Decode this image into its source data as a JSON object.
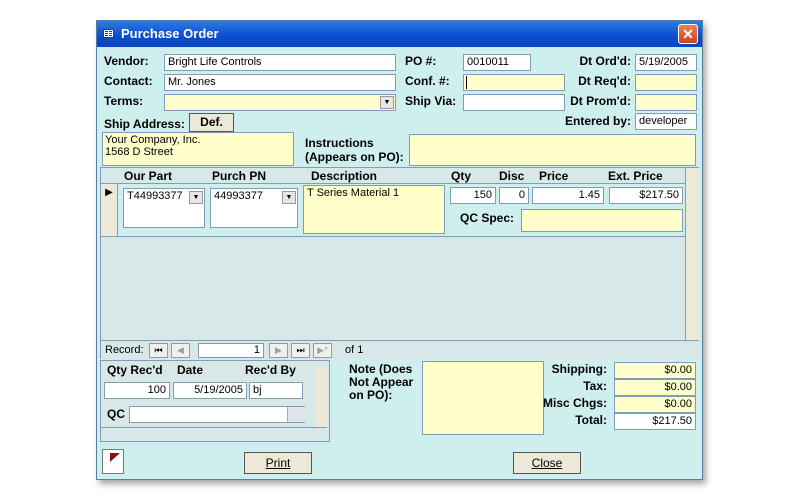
{
  "window": {
    "title": "Purchase Order",
    "close_glyph": "✕"
  },
  "header": {
    "vendor_label": "Vendor:",
    "vendor_value": "Bright Life Controls",
    "contact_label": "Contact:",
    "contact_value": "Mr. Jones",
    "terms_label": "Terms:",
    "terms_value": "",
    "po_label": "PO #:",
    "po_value": "0010011",
    "conf_label": "Conf. #:",
    "conf_value": "",
    "shipvia_label": "Ship Via:",
    "shipvia_value": "",
    "dtord_label": "Dt Ord'd:",
    "dtord_value": "5/19/2005",
    "dtreq_label": "Dt Req'd:",
    "dtreq_value": "",
    "dtprom_label": "Dt Prom'd:",
    "dtprom_value": "",
    "entered_label": "Entered by:",
    "entered_value": "developer",
    "ship_address_label": "Ship Address:",
    "def_button": "Def.",
    "ship_address_line1": "Your Company, Inc.",
    "ship_address_line2": "1568 D Street",
    "instructions_label_1": "Instructions",
    "instructions_label_2": "(Appears on PO):",
    "instructions_value": ""
  },
  "lines": {
    "columns": {
      "our_part": "Our Part",
      "purch_pn": "Purch PN",
      "description": "Description",
      "qty": "Qty",
      "disc": "Disc",
      "price": "Price",
      "ext_price": "Ext. Price"
    },
    "row": {
      "our_part": "T44993377",
      "purch_pn": "44993377",
      "description": "T Series Material 1",
      "qty": "150",
      "disc": "0",
      "price": "1.45",
      "ext_price": "$217.50"
    },
    "qc_spec_label": "QC Spec:",
    "qc_spec_value": "",
    "record_label": "Record:",
    "record_current": "1",
    "record_of": "of 1"
  },
  "receiving": {
    "qty_recd_label": "Qty Rec'd",
    "date_label": "Date",
    "recd_by_label": "Rec'd By",
    "qty_recd_value": "100",
    "date_value": "5/19/2005",
    "recd_by_value": "bj",
    "qc_label": "QC",
    "qc_value": ""
  },
  "note": {
    "label_1": "Note (Does",
    "label_2": "Not Appear",
    "label_3": "on PO):",
    "value": ""
  },
  "totals": {
    "shipping_label": "Shipping:",
    "shipping_value": "$0.00",
    "tax_label": "Tax:",
    "tax_value": "$0.00",
    "misc_label": "Misc Chgs:",
    "misc_value": "$0.00",
    "total_label": "Total:",
    "total_value": "$217.50"
  },
  "footer": {
    "print_button": "Print",
    "close_button": "Close"
  },
  "icons": {
    "dropdown": "▼",
    "first": "⏮",
    "prev": "◀",
    "next": "▶",
    "last": "⏭",
    "new": "▶*",
    "record_selector": "▶"
  }
}
